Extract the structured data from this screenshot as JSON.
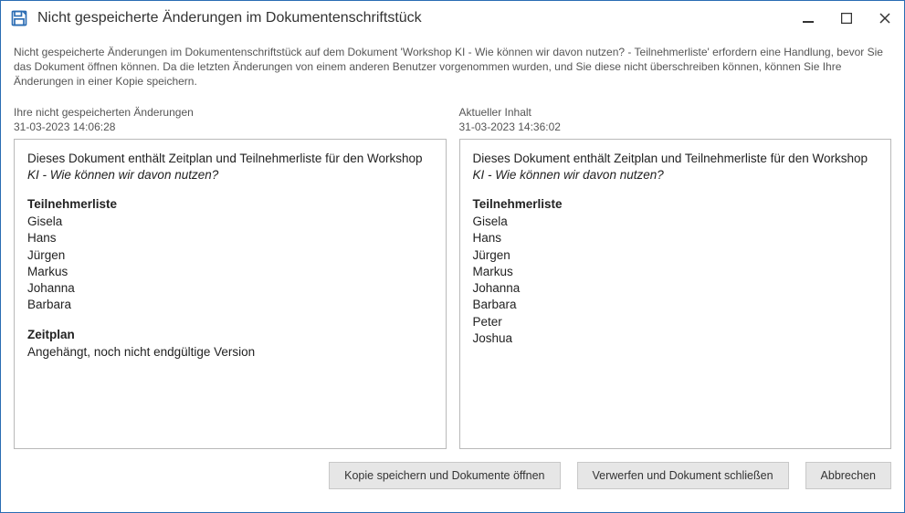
{
  "window": {
    "title": "Nicht gespeicherte Änderungen im Dokumentenschriftstück"
  },
  "description": "Nicht gespeicherte Änderungen im Dokumentenschriftstück auf dem Dokument 'Workshop KI - Wie können wir davon nutzen? - Teilnehmerliste' erfordern eine Handlung, bevor Sie das Dokument öffnen können. Da die letzten Änderungen von einem anderen Benutzer vorgenommen wurden, und Sie diese nicht überschreiben können, können Sie Ihre Änderungen in einer Kopie speichern.",
  "left": {
    "header": "Ihre nicht gespeicherten Änderungen",
    "timestamp": "31-03-2023 14:06:28",
    "intro_prefix": "Dieses Dokument enthält Zeitplan und Teilnehmerliste für den Workshop ",
    "intro_italic": "KI - Wie können wir davon nutzen?",
    "participants_title": "Teilnehmerliste",
    "participants": [
      "Gisela",
      "Hans",
      "Jürgen",
      "Markus",
      "Johanna",
      "Barbara"
    ],
    "schedule_title": "Zeitplan",
    "schedule_text": "Angehängt, noch nicht endgültige Version"
  },
  "right": {
    "header": "Aktueller Inhalt",
    "timestamp": "31-03-2023 14:36:02",
    "intro_prefix": "Dieses Dokument enthält Zeitplan und Teilnehmerliste für den Workshop ",
    "intro_italic": "KI - Wie können wir davon nutzen?",
    "participants_title": "Teilnehmerliste",
    "participants": [
      "Gisela",
      "Hans",
      "Jürgen",
      "Markus",
      "Johanna",
      "Barbara",
      "Peter",
      "Joshua"
    ]
  },
  "buttons": {
    "save_copy": "Kopie speichern und Dokumente öffnen",
    "discard_close": "Verwerfen und Dokument schließen",
    "cancel": "Abbrechen"
  }
}
